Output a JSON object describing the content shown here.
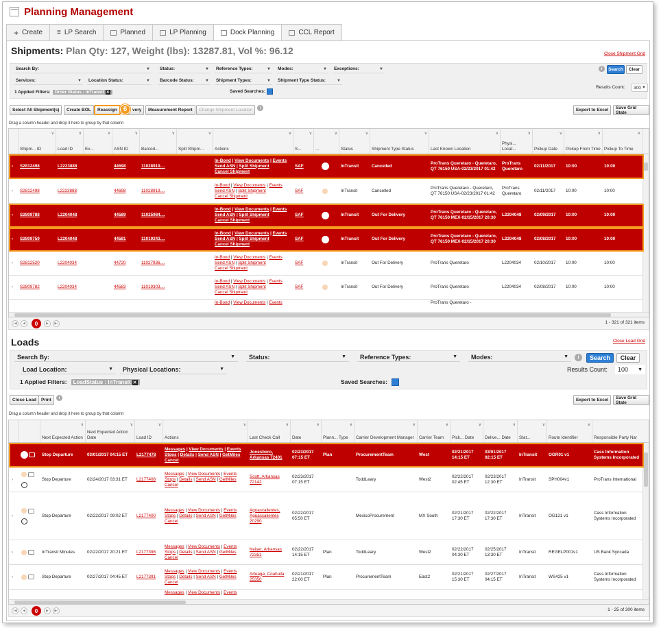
{
  "app": {
    "title": "Planning Management"
  },
  "tabs": [
    {
      "label": "Create",
      "icon": "plus-icon"
    },
    {
      "label": "LP Search",
      "icon": "list-icon"
    },
    {
      "label": "Planned",
      "icon": "calendar-icon"
    },
    {
      "label": "LP Planning",
      "icon": "calendar-icon"
    },
    {
      "label": "Dock Planning",
      "icon": "calendar-icon"
    },
    {
      "label": "CCL Report",
      "icon": "calendar-icon"
    }
  ],
  "shipments": {
    "title": "Shipments:",
    "summary": "Plan Qty: 127, Weight (lbs): 13287.81, Vol %: 96.12",
    "close_link": "Close Shipment Grid",
    "filters": {
      "search_by": "Search By:",
      "status": "Status:",
      "reference_types": "Reference Types:",
      "modes": "Modes:",
      "exceptions": "Exceptions:",
      "services": "Services:",
      "location_status": "Location Status:",
      "barcode_status": "Barcode Status:",
      "shipment_types": "Shipment Types:",
      "shipment_type_status": "Shipment Type Status:",
      "applied_label": "1 Applied Filters:",
      "applied_chip": "Order Status : InTransit",
      "saved_searches": "Saved Searches:",
      "search_btn": "Search",
      "clear_btn": "Clear",
      "results_count_label": "Results Count:",
      "results_count": "300"
    },
    "toolbar": {
      "select_all": "Select All Shipment(s)",
      "create_bol": "Create BOL",
      "reassign": "Reassign",
      "delivery": "very",
      "measurement": "Measurement Report",
      "change_location": "Change Shipment Location",
      "export": "Export to Excel",
      "save_grid": "Save Grid State",
      "step_badge": "6"
    },
    "drag_tip": "Drag a column header and drop it here to group by that column",
    "columns": [
      "Shipm... ID",
      "Load ID",
      "Ex...",
      "ASN ID",
      "Barcod...",
      "Split Shipm...",
      "Actions",
      "S...",
      "...",
      "Status",
      "Shipment Type Status",
      "Last Known Location",
      "Physi... Locat...",
      "Pickup Date",
      "Pickup From Time",
      "Pickup To Time"
    ],
    "actions": {
      "a1": "In-Bond",
      "a2": "View Documents",
      "a3": "Events",
      "a4": "Send ASN",
      "a5": "Split Shipment",
      "a6": "Cancel Shipment"
    },
    "rows": [
      {
        "id": "S2812498",
        "load": "L2223888",
        "asn": "44698",
        "barcode": "11028919....",
        "s": "SAF",
        "status": "InTransit",
        "type_status": "Cancelled",
        "location": "ProTrans Queretaro - Queretaro, QT 76150 USA-02/23/2017 01:42",
        "physical": "ProTrans Queretaro",
        "pickup_date": "02/11/2017",
        "from": "10:00",
        "to": "10:00"
      },
      {
        "id": "S2812498",
        "load": "L2223888",
        "asn": "44698",
        "barcode": "11028919....",
        "s": "SAF",
        "status": "InTransit",
        "type_status": "Cancelled",
        "location": "ProTrans Queretaro - Queretaro, QT 76150 USA-02/23/2017 01:42",
        "physical": "ProTrans Queretaro",
        "pickup_date": "02/11/2017",
        "from": "10:00",
        "to": "10:00"
      },
      {
        "id": "S2809788",
        "load": "L2204048",
        "asn": "44589",
        "barcode": "11025984....",
        "s": "SAF",
        "status": "InTransit",
        "type_status": "Out For Delivery",
        "location": "ProTrans Queretaro - Queretaro, QT 76150 MEX-02/15/2017 20:30",
        "physical": "L2204048",
        "pickup_date": "02/09/2017",
        "from": "10:00",
        "to": "10:00"
      },
      {
        "id": "S2809759",
        "load": "L2204048",
        "asn": "44581",
        "barcode": "11019243....",
        "s": "SAF",
        "status": "InTransit",
        "type_status": "Out For Delivery",
        "location": "ProTrans Queretaro - Queretaro, QT 76150 MEX-02/15/2017 20:30",
        "physical": "L2204048",
        "pickup_date": "02/08/2017",
        "from": "10:00",
        "to": "10:00"
      },
      {
        "id": "S2812520",
        "load": "L2204034",
        "asn": "44720",
        "barcode": "11027936....",
        "s": "SAF",
        "status": "InTransit",
        "type_status": "Out For Delivery",
        "location": "ProTrans Queretaro",
        "physical": "L2204034",
        "pickup_date": "02/10/2017",
        "from": "10:00",
        "to": "10:00"
      },
      {
        "id": "S2809782",
        "load": "L2204034",
        "asn": "44583",
        "barcode": "11019303....",
        "s": "SAF",
        "status": "InTransit",
        "type_status": "Out For Delivery",
        "location": "ProTrans Queretaro",
        "physical": "L2204034",
        "pickup_date": "02/08/2017",
        "from": "10:00",
        "to": "10:00"
      },
      {
        "id": "",
        "load": "",
        "asn": "",
        "barcode": "",
        "s": "",
        "status": "",
        "type_status": "",
        "location": "ProTrans Queretaro -",
        "physical": "",
        "pickup_date": "",
        "from": "",
        "to": ""
      }
    ],
    "pager": {
      "current": "0",
      "count": "1 - 321 of 321 items"
    }
  },
  "loads": {
    "title": "Loads",
    "close_link": "Close Load Grid",
    "filters": {
      "search_by": "Search By:",
      "status": "Status:",
      "reference_types": "Reference Types:",
      "modes": "Modes:",
      "load_location": "Load Location:",
      "physical_locations": "Physical Locations:",
      "applied_label": "1 Applied Filters:",
      "applied_chip": "LoadStatus : InTransit",
      "saved_searches": "Saved Searches:",
      "search_btn": "Search",
      "clear_btn": "Clear",
      "results_count_label": "Results Count:",
      "results_count": "100"
    },
    "toolbar": {
      "close_load": "Close Load",
      "print": "Print",
      "export": "Export to Excel",
      "save_grid": "Save Grid State"
    },
    "drag_tip": "Drag a column header and drop it here to group by that column",
    "columns": [
      "Next Expected Action",
      "Next Expected Action Date",
      "Load ID",
      "Actions",
      "Last Check Call",
      "Date",
      "Plann... Type",
      "Carrier Development Manager",
      "Carrier Team",
      "Pick... Date",
      "Delive... Date",
      "Stat...",
      "Route Identifier",
      "Responsible Party Nar"
    ],
    "actions": {
      "a1": "Messages",
      "a2": "View Documents",
      "a3": "Events",
      "a4": "Stops",
      "a5": "Details",
      "a6": "Send ASN",
      "a7": "GetMiles",
      "a8": "Cancel"
    },
    "rows": [
      {
        "next": "Stop Departure",
        "next_date": "03/01/2017 04:15 ET",
        "load": "L2177478",
        "check_call": "Jonesboro, Arkansas 72401",
        "date": "02/23/2017 07:15 ET",
        "plan_type": "Plan",
        "manager": "ProcurementTeam",
        "team": "West",
        "pick": "02/21/2017 14:15 ET",
        "deliv": "03/01/2017 02:15 ET",
        "stat": "InTransit",
        "route": "OGR01 v1",
        "party": "Cass Information Systems Incorporated"
      },
      {
        "next": "Stop Departure",
        "next_date": "02/24/2017 03:31 ET",
        "load": "L2177408",
        "check_call": "Scott, Arkansas 72142",
        "date": "02/23/2017 07:15 ET",
        "plan_type": "",
        "manager": "ToddLeary",
        "team": "West2",
        "pick": "02/22/2017 02:45 ET",
        "deliv": "02/23/2017 12:30 ET",
        "stat": "InTransit",
        "route": "SPH004v1",
        "party": "ProTrans International"
      },
      {
        "next": "Stop Departure",
        "next_date": "02/22/2017 09:02 ET",
        "load": "L2177400",
        "check_call": "Aguascalientes, Aguascalientes 20290",
        "date": "02/22/2017 05:50 ET",
        "plan_type": "",
        "manager": "MexicoProcurement",
        "team": "MX South",
        "pick": "02/21/2017 17:30 ET",
        "deliv": "02/22/2017 17:30 ET",
        "stat": "InTransit",
        "route": "OG121 v1",
        "party": "Cass Information Systems Incorporated"
      },
      {
        "next": "InTransit Minutes",
        "next_date": "02/22/2017 20:21 ET",
        "load": "L2177398",
        "check_call": "Keiser, Arkansas 72351",
        "date": "02/22/2017 14:15 ET",
        "plan_type": "Plan",
        "manager": "ToddLeary",
        "team": "West2",
        "pick": "02/22/2017 04:30 ET",
        "deliv": "02/25/2017 13:30 ET",
        "stat": "InTransit",
        "route": "REGELP001v1",
        "party": "US Bank Syncada"
      },
      {
        "next": "Stop Departure",
        "next_date": "02/27/2017 04:45 ET",
        "load": "L2177391",
        "check_call": "Arteaga, Coahuila 25350",
        "date": "02/21/2017 22:00 ET",
        "plan_type": "Plan",
        "manager": "ProcurementTeam",
        "team": "East2",
        "pick": "02/21/2017 15:30 ET",
        "deliv": "02/27/2017 04:15 ET",
        "stat": "InTransit",
        "route": "WS425 v1",
        "party": "Cass Information Systems Incorporated"
      }
    ],
    "pager": {
      "current": "0",
      "count": "1 - 25 of 300 items"
    }
  }
}
